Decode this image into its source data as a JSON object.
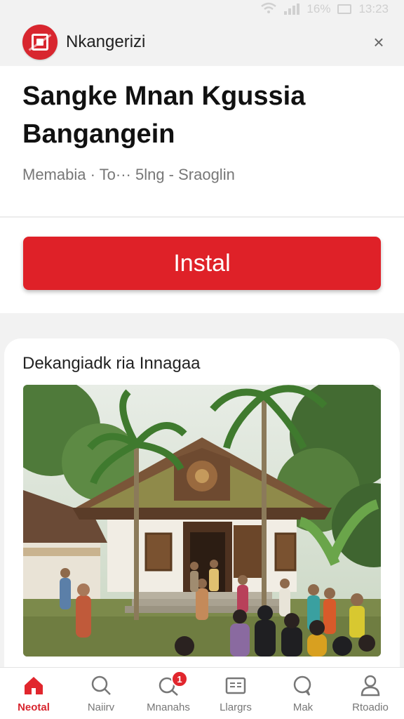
{
  "status_bar": {
    "battery": "16%",
    "time": "13:23"
  },
  "header": {
    "app_name": "Nkangerizi"
  },
  "hero": {
    "title_line1": "Sangke Mnan Kgussia",
    "title_line2": "Bangangein",
    "meta": "Memabia · To··· 5lng - Sraoglin"
  },
  "install": {
    "label": "Instal"
  },
  "card": {
    "title": "Dekangiadk ria Innagaa"
  },
  "nav": [
    {
      "label": "Neotal",
      "icon": "home-icon",
      "active": true
    },
    {
      "label": "Naiirv",
      "icon": "search-icon"
    },
    {
      "label": "Mnanahs",
      "icon": "notification-search-icon",
      "badge": "1"
    },
    {
      "label": "Llargrs",
      "icon": "id-card-icon"
    },
    {
      "label": "Mak",
      "icon": "chat-search-icon"
    },
    {
      "label": "Rtoadio",
      "icon": "profile-icon"
    }
  ],
  "colors": {
    "accent": "#df2128",
    "badge": "#e1262d"
  }
}
